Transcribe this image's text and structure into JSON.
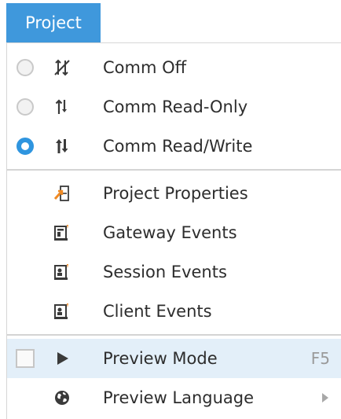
{
  "menubar": {
    "active_menu": "Project",
    "accent_color": "#3f98dc"
  },
  "menu": {
    "comm_items": [
      {
        "label": "Comm Off",
        "checked": false,
        "icon": "comm-off-icon"
      },
      {
        "label": "Comm Read-Only",
        "checked": false,
        "icon": "comm-read-only-icon"
      },
      {
        "label": "Comm Read/Write",
        "checked": true,
        "icon": "comm-read-write-icon"
      }
    ],
    "project_items": [
      {
        "label": "Project Properties",
        "icon": "project-properties-icon"
      },
      {
        "label": "Gateway Events",
        "icon": "gateway-events-icon"
      },
      {
        "label": "Session Events",
        "icon": "session-events-icon"
      },
      {
        "label": "Client Events",
        "icon": "client-events-icon"
      }
    ],
    "preview_mode": {
      "label": "Preview Mode",
      "shortcut": "F5",
      "checked": false,
      "icon": "play-icon",
      "highlighted": true
    },
    "preview_language": {
      "label": "Preview Language",
      "icon": "globe-icon",
      "has_submenu": true
    }
  },
  "colors": {
    "radio_selected": "#2f95df",
    "highlight_background": "#e3eff9",
    "icon_dark": "#3a3a3a",
    "icon_orange": "#f08a24"
  }
}
